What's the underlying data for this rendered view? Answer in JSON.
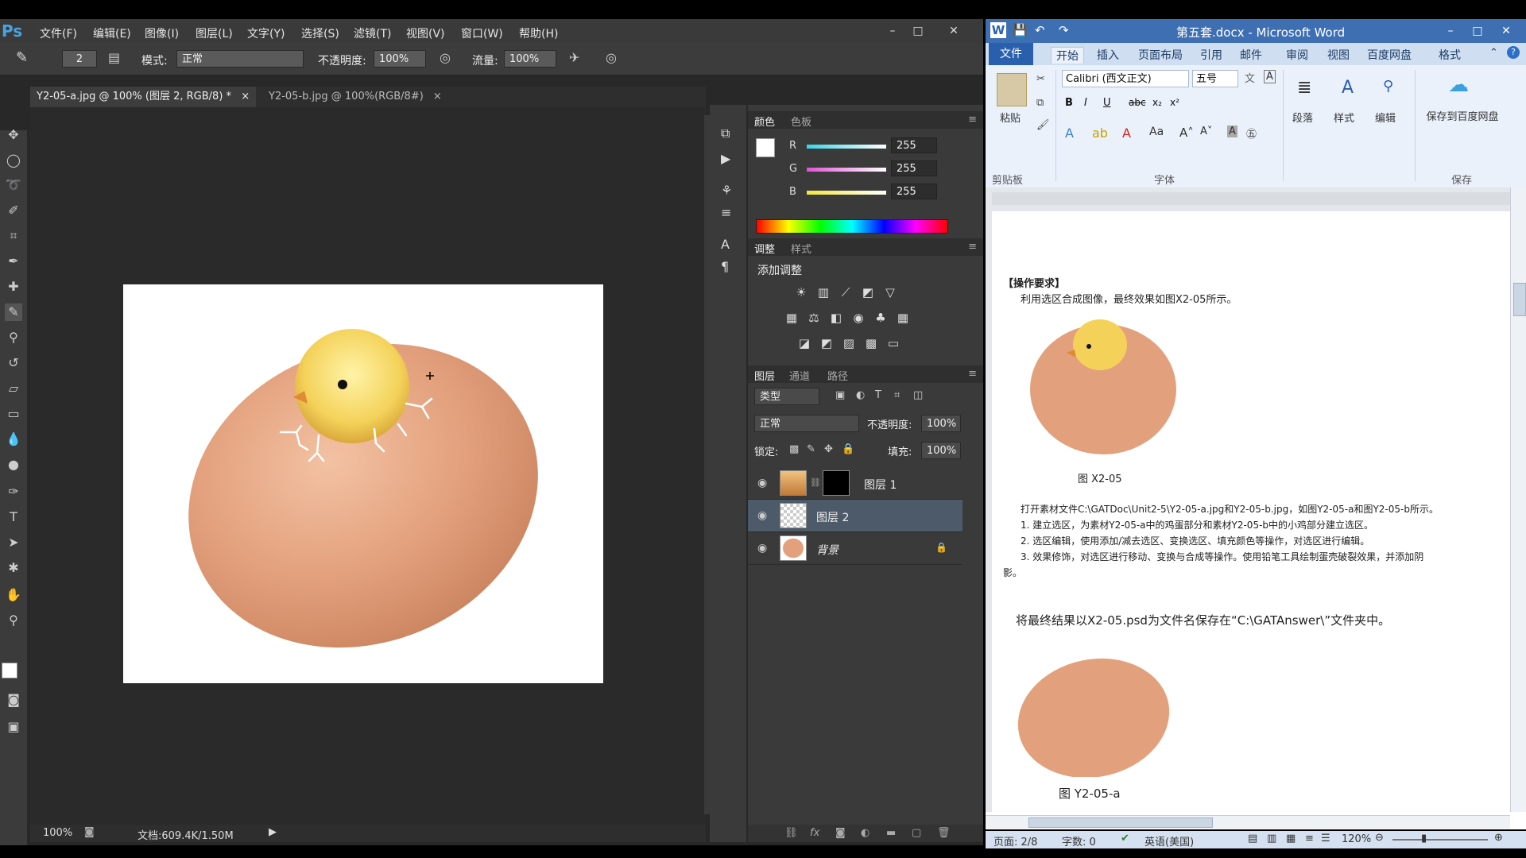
{
  "photoshop": {
    "logo": "Ps",
    "menus": [
      "文件(F)",
      "编辑(E)",
      "图像(I)",
      "图层(L)",
      "文字(Y)",
      "选择(S)",
      "滤镜(T)",
      "视图(V)",
      "窗口(W)",
      "帮助(H)"
    ],
    "window_controls": {
      "minimize": "–",
      "maximize": "□",
      "close": "✕"
    },
    "options": {
      "brush_size": "2",
      "mode_label": "模式:",
      "mode_value": "正常",
      "opacity_label": "不透明度:",
      "opacity_value": "100%",
      "flow_label": "流量:",
      "flow_value": "100%"
    },
    "tabs": [
      {
        "label": "Y2-05-a.jpg @ 100% (图层 2, RGB/8) *",
        "close": "×"
      },
      {
        "label": "Y2-05-b.jpg @ 100%(RGB/8#)",
        "close": "×"
      }
    ],
    "status": {
      "zoom": "100%",
      "doc_info": "文档:609.4K/1.50M"
    },
    "color_panel": {
      "tabs": [
        "颜色",
        "色板"
      ],
      "channels": [
        {
          "label": "R",
          "value": "255",
          "color": "#36d6e6"
        },
        {
          "label": "G",
          "value": "255",
          "color": "#e052d8"
        },
        {
          "label": "B",
          "value": "255",
          "color": "#f2e83a"
        }
      ]
    },
    "adjustments_panel": {
      "tabs": [
        "调整",
        "样式"
      ],
      "title": "添加调整"
    },
    "layers_panel": {
      "tabs": [
        "图层",
        "通道",
        "路径"
      ],
      "filter_label": "类型",
      "blend_mode": "正常",
      "opacity_label": "不透明度:",
      "opacity_value": "100%",
      "lock_label": "锁定:",
      "fill_label": "填充:",
      "fill_value": "100%",
      "layers": [
        {
          "name": "图层 1",
          "selected": false
        },
        {
          "name": "图层 2",
          "selected": true
        },
        {
          "name": "背景",
          "selected": false,
          "locked": true
        }
      ]
    }
  },
  "word": {
    "title": "第五套.docx - Microsoft Word",
    "window_controls": {
      "minimize": "–",
      "maximize": "□",
      "close": "✕"
    },
    "tabs": [
      "开始",
      "插入",
      "页面布局",
      "引用",
      "邮件",
      "审阅",
      "视图",
      "百度网盘",
      "格式"
    ],
    "file_tab": "文件",
    "ribbon": {
      "paste": "粘贴",
      "font_name": "Calibri (西文正文)",
      "font_size": "五号",
      "paragraph": "段落",
      "styles": "样式",
      "editing": "编辑",
      "save_baidu": "保存到百度网盘",
      "groups": [
        "剪贴板",
        "字体",
        "保存"
      ]
    },
    "document": {
      "heading": "【操作要求】",
      "intro": "利用选区合成图像，最终效果如图X2-05所示。",
      "caption1": "图 X2-05",
      "line1": "打开素材文件C:\\GATDoc\\Unit2-5\\Y2-05-a.jpg和Y2-05-b.jpg，如图Y2-05-a和图Y2-05-b所示。",
      "step1": "1. 建立选区，为素材Y2-05-a中的鸡蛋部分和素材Y2-05-b中的小鸡部分建立选区。",
      "step2": "2. 选区编辑，使用添加/减去选区、变换选区、填充颜色等操作，对选区进行编辑。",
      "step3": "3. 效果修饰，对选区进行移动、变换与合成等操作。使用铅笔工具绘制蛋壳破裂效果，并添加阴",
      "step3b": "影。",
      "save_line": "将最终结果以X2-05.psd为文件名保存在“C:\\GATAnswer\\”文件夹中。",
      "caption2": "图 Y2-05-a"
    },
    "status": {
      "page": "页面: 2/8",
      "words": "字数: 0",
      "language": "英语(美国)",
      "zoom": "120%"
    }
  }
}
